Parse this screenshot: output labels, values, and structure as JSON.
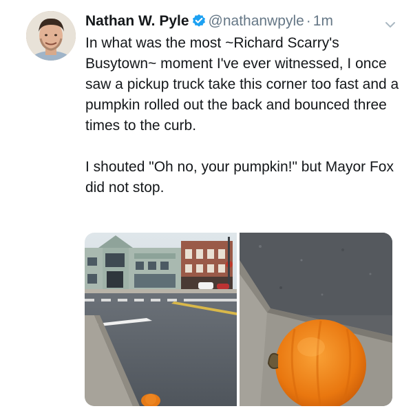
{
  "tweet": {
    "display_name": "Nathan W. Pyle",
    "handle": "@nathanwpyle",
    "separator": "·",
    "time": "1m",
    "text": "In what was the most ~Richard Scarry's Busytown~ moment I've ever witnessed, I once saw a pickup truck take this corner too fast and a pumpkin rolled out the back and bounced three times to the curb.\n\nI shouted \"Oh no, your pumpkin!\" but Mayor Fox did not stop."
  },
  "icons": {
    "verified": "verified-badge-icon",
    "more": "chevron-down-icon"
  },
  "colors": {
    "verified": "#1da1f2",
    "secondary_text": "#657786",
    "primary_text": "#14171a"
  },
  "media": {
    "count": 2,
    "left_photo": "street corner with crosswalk and buildings",
    "right_photo": "orange pumpkin resting on curb"
  }
}
